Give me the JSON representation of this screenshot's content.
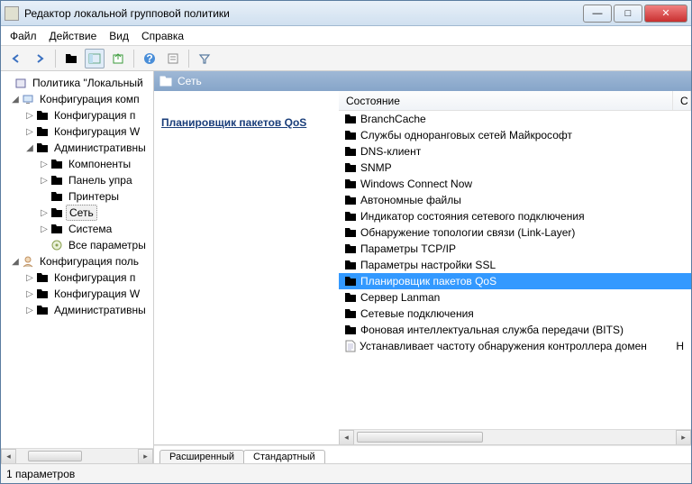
{
  "window": {
    "title": "Редактор локальной групповой политики"
  },
  "menu": {
    "file": "Файл",
    "action": "Действие",
    "view": "Вид",
    "help": "Справка"
  },
  "tree": {
    "root": "Политика \"Локальный",
    "comp_conf": "Конфигурация комп",
    "soft": "Конфигурация п",
    "win1": "Конфигурация W",
    "admin": "Административны",
    "components": "Компоненты",
    "panel": "Панель упра",
    "printers": "Принтеры",
    "net": "Сеть",
    "system": "Система",
    "allparams": "Все параметры",
    "user_conf": "Конфигурация поль",
    "u_soft": "Конфигурация п",
    "u_win": "Конфигурация W",
    "u_admin": "Административны"
  },
  "header": {
    "folder": "Сеть"
  },
  "detail": {
    "heading": "Планировщик пакетов QoS"
  },
  "columns": {
    "state": "Состояние",
    "c": "С"
  },
  "items": [
    "BranchCache",
    "Службы одноранговых сетей Майкрософт",
    "DNS-клиент",
    "SNMP",
    "Windows Connect Now",
    "Автономные файлы",
    "Индикатор состояния сетевого подключения",
    "Обнаружение топологии связи (Link-Layer)",
    "Параметры TCP/IP",
    "Параметры настройки SSL",
    "Планировщик пакетов QoS",
    "Сервер Lanman",
    "Сетевые подключения",
    "Фоновая интеллектуальная служба передачи (BITS)"
  ],
  "docitem": {
    "label": "Устанавливает частоту обнаружения контроллера домен",
    "col2": "Н"
  },
  "tabs": {
    "ext": "Расширенный",
    "std": "Стандартный"
  },
  "status": {
    "text": "1 параметров"
  }
}
